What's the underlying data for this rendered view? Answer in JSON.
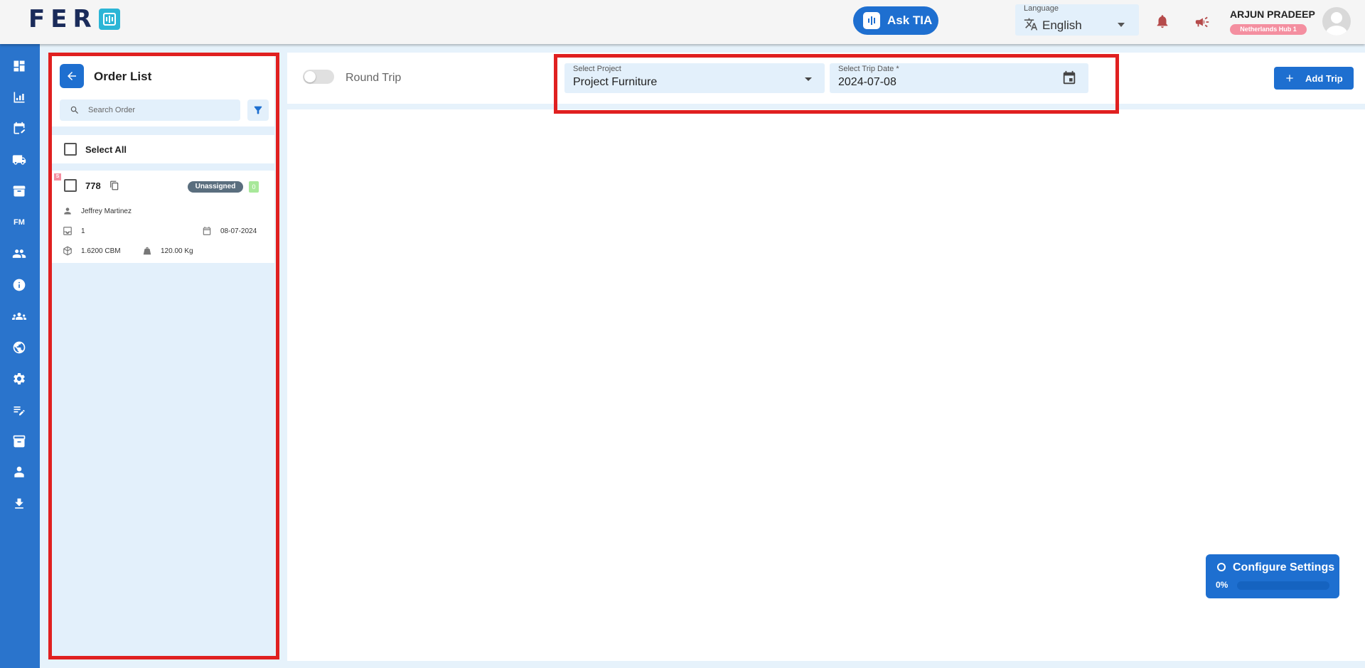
{
  "header": {
    "logo_text": "FER",
    "ask_tia_label": "Ask TIA",
    "language": {
      "label": "Language",
      "value": "English"
    },
    "user": {
      "name": "ARJUN PRADEEP",
      "hub": "Netherlands Hub 1"
    }
  },
  "nav": {
    "items": [
      "dashboard-icon",
      "analytics-icon",
      "calendar-edit-icon",
      "truck-icon",
      "archive-icon",
      "FM",
      "people-icon",
      "info-icon",
      "groups-icon",
      "support-icon",
      "settings-icon",
      "edit-note-icon",
      "inventory-icon",
      "admin-icon",
      "download-icon"
    ]
  },
  "order_list": {
    "title": "Order List",
    "search_placeholder": "Search Order",
    "select_all_label": "Select All",
    "orders": [
      {
        "tag": "S",
        "id": "778",
        "status": "Unassigned",
        "count": "0",
        "customer": "Jeffrey Martinez",
        "quantity": "1",
        "date": "08-07-2024",
        "volume": "1.6200 CBM",
        "weight": "120.00 Kg"
      }
    ]
  },
  "toolbar": {
    "round_trip_label": "Round Trip",
    "project": {
      "label": "Select Project",
      "value": "Project Furniture"
    },
    "trip_date": {
      "label": "Select Trip Date *",
      "value": "2024-07-08"
    },
    "add_trip_label": "Add Trip"
  },
  "config": {
    "title": "Configure Settings",
    "progress_label": "0%",
    "progress": 0
  },
  "colors": {
    "primary": "#1e6fd0",
    "nav": "#2a74cc",
    "highlight": "#e02020",
    "status_unassigned": "#5a6e7e",
    "hub_badge": "#f48fa0"
  }
}
